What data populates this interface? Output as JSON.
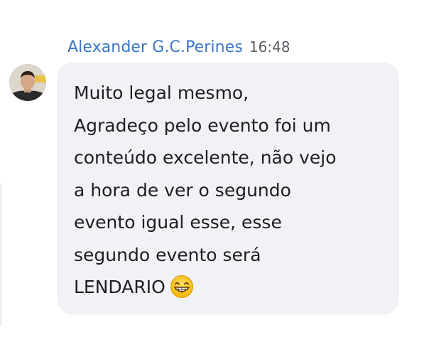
{
  "message": {
    "sender_name": "Alexander G.C.Perines",
    "timestamp": "16:48",
    "lines": [
      "Muito legal mesmo,",
      "Agradeço pelo evento foi um",
      "conteúdo excelente, não vejo",
      "a hora de ver o segundo",
      "evento igual esse, esse",
      "segundo evento será",
      "LENDARIO"
    ],
    "emoji": "grinning-face-with-smiling-eyes-icon"
  },
  "colors": {
    "sender_name": "#3a76c4",
    "bubble_background": "#f1f2f5",
    "message_text": "#1c1e21"
  }
}
